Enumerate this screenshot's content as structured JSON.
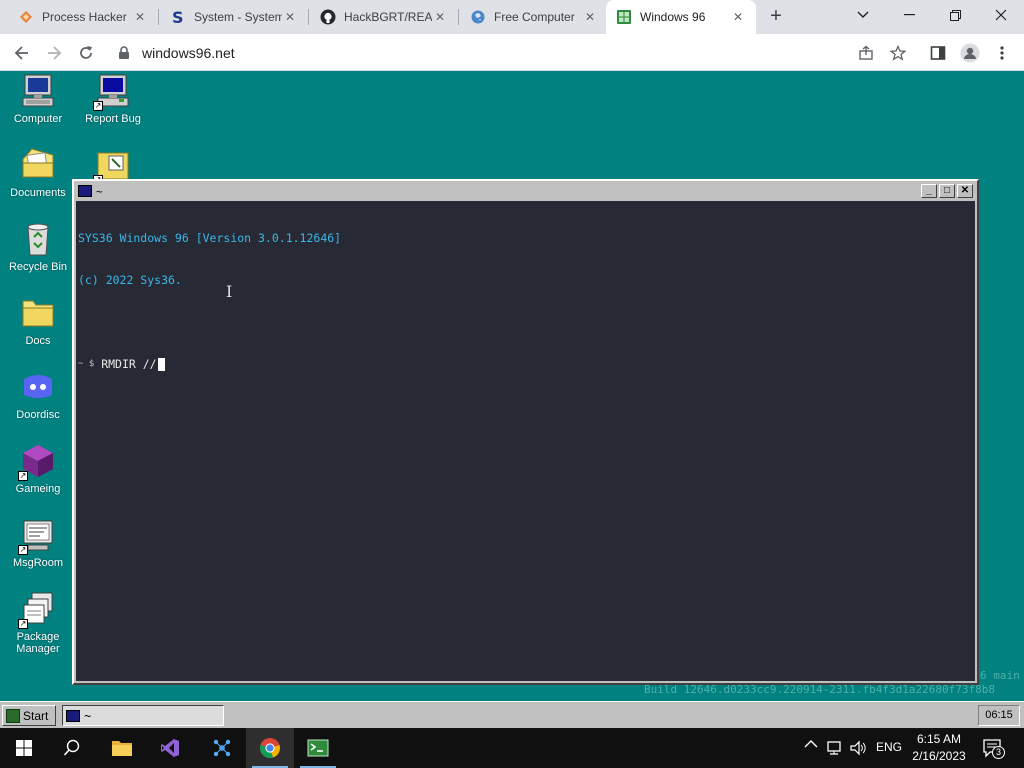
{
  "browser": {
    "tabs": [
      {
        "title": "Process Hacker",
        "icon": "process-hacker-icon"
      },
      {
        "title": "System - System",
        "icon": "s-logo-icon"
      },
      {
        "title": "HackBGRT/REAL",
        "icon": "github-icon"
      },
      {
        "title": "Free Computer",
        "icon": "globe-icon"
      },
      {
        "title": "Windows 96",
        "icon": "windows96-icon",
        "active": true
      }
    ],
    "new_tab": "+",
    "address": "windows96.net"
  },
  "desktop": {
    "icons": [
      {
        "label": "Computer",
        "icon": "computer-icon"
      },
      {
        "label": "Report Bug",
        "icon": "report-bug-icon"
      },
      {
        "label": "Documents",
        "icon": "documents-folder-icon"
      },
      {
        "label": "",
        "icon": "shortcut-folder-icon"
      },
      {
        "label": "Recycle Bin",
        "icon": "recycle-bin-icon"
      },
      {
        "label": "Docs",
        "icon": "docs-folder-icon"
      },
      {
        "label": "Doordisc",
        "icon": "doordisc-icon"
      },
      {
        "label": "Gameing",
        "icon": "gameing-cube-icon"
      },
      {
        "label": "MsgRoom",
        "icon": "msgroom-icon"
      },
      {
        "label": "Package Manager",
        "icon": "package-manager-icon"
      }
    ],
    "build_line_1": "6 main",
    "build_line_2": "Build 12646.d0233cc9.220914-2311.fb4f3d1a22680f73f8b8"
  },
  "terminal": {
    "title": "~",
    "lines": [
      "SYS36 Windows 96 [Version 3.0.1.12646]",
      "(c) 2022 Sys36."
    ],
    "prompt_prefix": "~ $",
    "command": "RMDIR //"
  },
  "win96_taskbar": {
    "start_label": "Start",
    "task_label": "~",
    "clock": "06:15"
  },
  "windows_taskbar": {
    "language": "ENG",
    "time": "6:15 AM",
    "date": "2/16/2023",
    "notifications": "3"
  }
}
